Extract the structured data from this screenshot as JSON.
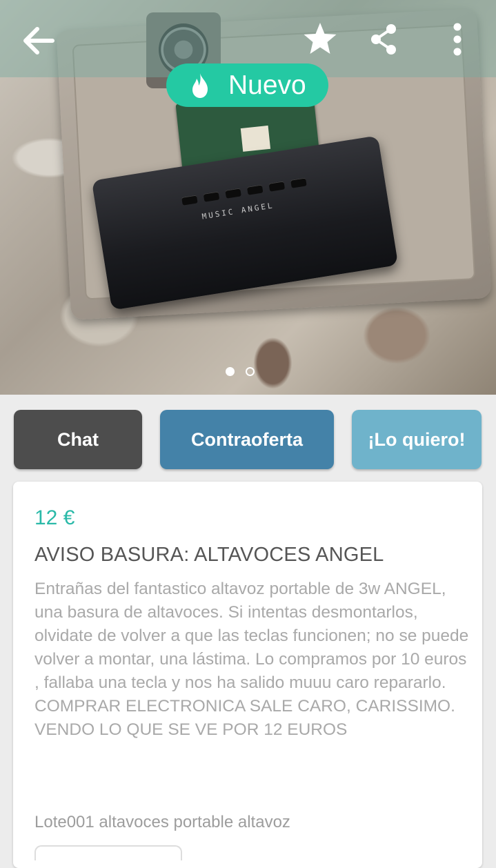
{
  "header": {
    "back_icon": "arrow-left-icon",
    "favorite_icon": "star-icon",
    "share_icon": "share-icon",
    "more_icon": "more-vertical-icon"
  },
  "badge": {
    "icon": "flame-icon",
    "label": "Nuevo",
    "color": "#24c9a3"
  },
  "gallery": {
    "photo_text": "MUSIC ANGEL",
    "page_count": 2,
    "current_page": 1
  },
  "actions": {
    "chat_label": "Chat",
    "offer_label": "Contraoferta",
    "want_label": "¡Lo quiero!"
  },
  "listing": {
    "price": "12 €",
    "title": "AVISO BASURA: ALTAVOCES ANGEL",
    "description": "Entrañas del fantastico altavoz portable de 3w ANGEL, una basura de  altavoces. Si intentas desmontarlos, olvidate de volver a que las teclas funcionen; no se puede volver a montar, una lástima. Lo compramos por 10 euros , fallaba una tecla y nos ha salido muuu caro repararlo. COMPRAR ELECTRONICA SALE CARO, CARISSIMO. VENDO LO QUE SE VE POR 12 EUROS",
    "tags": "Lote001 altavoces portable altavoz"
  },
  "colors": {
    "accent": "#24c9a3",
    "price": "#2ab9a8",
    "chat_button": "#4d4d4d",
    "offer_button": "#4482a8",
    "want_button": "#6fb3cb"
  }
}
